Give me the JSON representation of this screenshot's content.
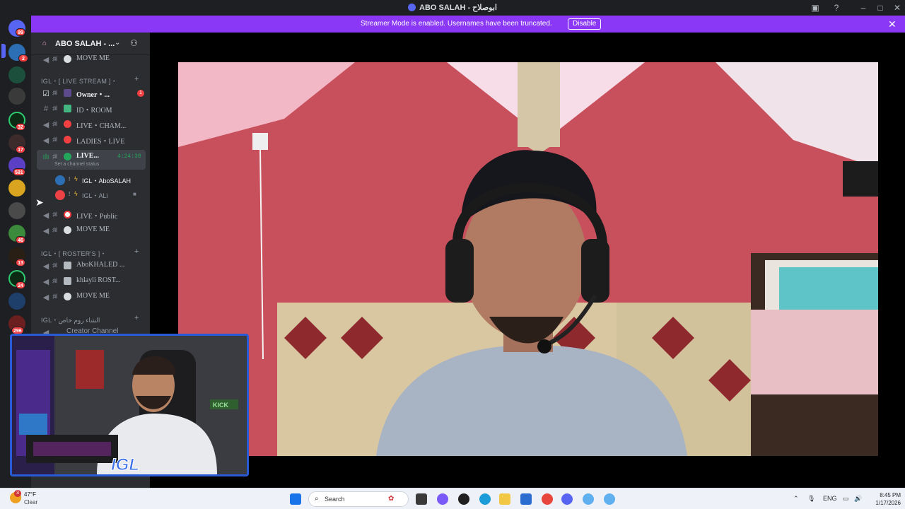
{
  "window": {
    "title": "ABO SALAH - ابوصلاح",
    "icons": [
      "inbox-icon",
      "help-icon"
    ],
    "controls": [
      "minimize",
      "maximize",
      "close"
    ]
  },
  "banner": {
    "message": "Streamer Mode is enabled. Usernames have been truncated.",
    "button": "Disable"
  },
  "rail": {
    "badges": [
      "99",
      "2",
      "32",
      "17",
      "581",
      "46",
      "13",
      "24",
      "296"
    ]
  },
  "server": {
    "name": "ABO SALAH - ..."
  },
  "sidebar": {
    "top_item": "MOVE ME",
    "category1": "IGL・[ LIVE STREAM ]・",
    "channels": [
      {
        "label": "Owner・...",
        "unread": "1"
      },
      {
        "label": "ID・ROOM"
      },
      {
        "label": "LIVE・CHAM..."
      },
      {
        "label": "LADIES・LIVE"
      },
      {
        "label": "LIVE...",
        "timer": "4:24:30",
        "status": "Set a channel status"
      },
      {
        "label": "LIVE・Public"
      },
      {
        "label": "MOVE ME"
      }
    ],
    "voice_users": [
      {
        "name": "IGL・AboSALAH"
      },
      {
        "name": "IGL・ALi"
      }
    ],
    "category2": "IGL・[ ROSTER'S ]・",
    "roster": [
      {
        "label": "AboKHALED ..."
      },
      {
        "label": "khlayli ROST..."
      },
      {
        "label": "MOVE ME"
      }
    ],
    "category3": "IGL・الشاء روم خاص",
    "creator": "Creator Channel"
  },
  "webcam": {
    "overlay_text": "IGL",
    "sign": "KICK"
  },
  "taskbar": {
    "weather": {
      "temp": "47°F",
      "condition": "Clear",
      "alert": "3"
    },
    "search_placeholder": "Search",
    "language": "ENG",
    "time": "8:45 PM",
    "date": "1/17/2026"
  },
  "colors": {
    "accent": "#8a38f5",
    "voice_green": "#23a55a",
    "danger": "#f23f42",
    "sidebar_bg": "#2b2d31",
    "rail_bg": "#1e1f22"
  }
}
